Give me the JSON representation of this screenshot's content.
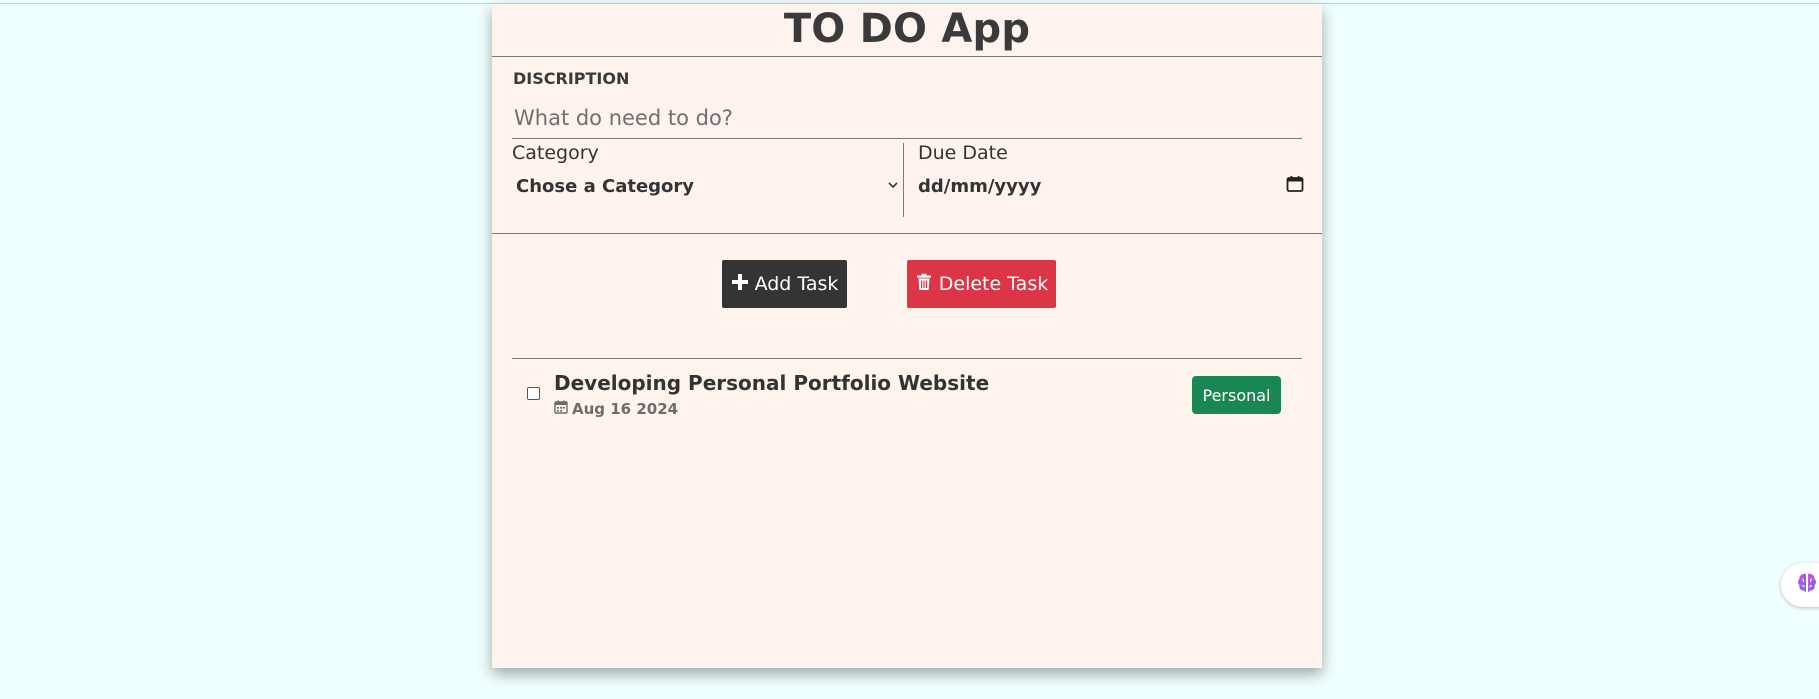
{
  "app": {
    "title": "TO DO App"
  },
  "form": {
    "description_label": "DISCRIPTION",
    "description_placeholder": "What do need to do?",
    "category_label": "Category",
    "category_selected": "Chose a Category",
    "due_date_label": "Due Date",
    "due_date_value": "dd/mm/yyyy"
  },
  "actions": {
    "add_label": "Add Task",
    "delete_label": "Delete Task"
  },
  "tasks": [
    {
      "title": "Developing Personal Portfolio Website",
      "date": "Aug 16 2024",
      "category": "Personal",
      "checked": false
    }
  ],
  "icons": {
    "add": "plus-icon",
    "delete": "trash-icon",
    "date": "calendar-icon",
    "picker": "calendar-icon",
    "select": "chevron-down-icon",
    "floating": "brain-icon"
  },
  "colors": {
    "page_bg": "#f0ffff",
    "card_bg": "#fff3ee",
    "add_button": "#343434",
    "delete_button": "#dc3545",
    "badge_personal": "#198754"
  }
}
